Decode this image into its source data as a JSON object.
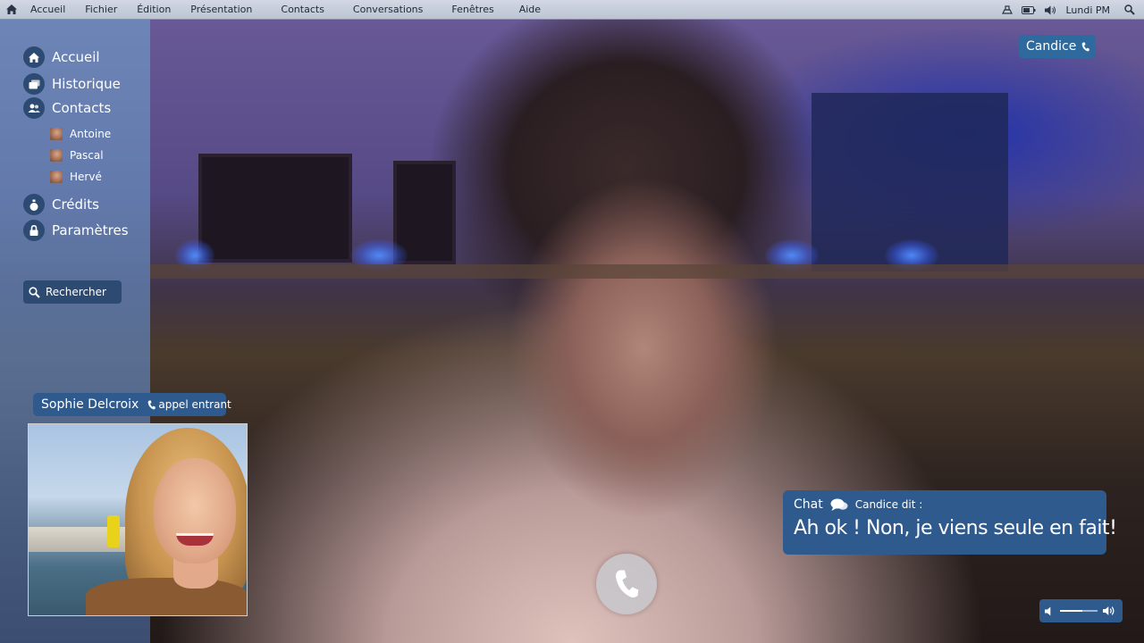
{
  "menubar": {
    "items": [
      "Accueil",
      "Fichier",
      "Édition",
      "Présentation",
      "Contacts",
      "Conversations",
      "Fenêtres",
      "Aide"
    ],
    "clock": "Lundi PM"
  },
  "sidebar": {
    "nav": {
      "home": "Accueil",
      "history": "Historique",
      "contacts": "Contacts",
      "credits": "Crédits",
      "settings": "Paramètres"
    },
    "contacts": [
      "Antoine",
      "Pascal",
      "Hervé"
    ],
    "search_label": "Rechercher"
  },
  "incoming_call": {
    "name": "Sophie Delcroix",
    "status": "appel entrant"
  },
  "current_contact": {
    "name": "Candice"
  },
  "chat": {
    "label": "Chat",
    "sender": "Candice dit :",
    "message": "Ah ok ! Non, je viens seule en fait!"
  },
  "volume": {
    "level": 0.6
  },
  "colors": {
    "panel_blue": "#2e5a8e",
    "sidebar_blue": "#6e8ebe",
    "icon_circle": "#2c4a72",
    "menubar": "#c8ceda"
  },
  "icons": {
    "menubar_home": "home-icon",
    "status": [
      "network-icon",
      "battery-icon",
      "volume-icon",
      "search-icon"
    ],
    "nav": [
      "home-icon",
      "history-icon",
      "contacts-icon",
      "credits-icon",
      "lock-icon"
    ],
    "chat": "speech-bubbles-icon",
    "call": "phone-icon"
  }
}
